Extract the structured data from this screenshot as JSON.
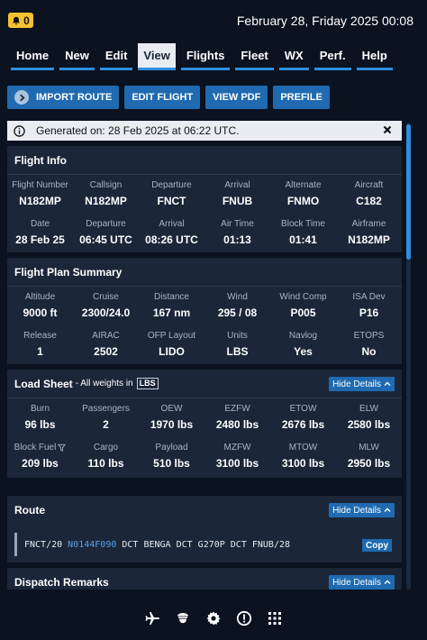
{
  "status": {
    "notification_count": "0",
    "datetime": "February 28, Friday 2025 00:08"
  },
  "tabs": [
    {
      "label": "Home"
    },
    {
      "label": "New"
    },
    {
      "label": "Edit"
    },
    {
      "label": "View"
    },
    {
      "label": "Flights"
    },
    {
      "label": "Fleet"
    },
    {
      "label": "WX"
    },
    {
      "label": "Perf."
    },
    {
      "label": "Help"
    }
  ],
  "active_tab": "View",
  "actions": {
    "import_route": "IMPORT ROUTE",
    "edit_flight": "EDIT FLIGHT",
    "view_pdf": "VIEW PDF",
    "prefile": "PREFILE"
  },
  "generated": "Generated on: 28 Feb 2025 at 06:22 UTC.",
  "flight_info": {
    "title": "Flight Info",
    "fields": [
      {
        "label": "Flight Number",
        "value": "N182MP"
      },
      {
        "label": "Callsign",
        "value": "N182MP"
      },
      {
        "label": "Departure",
        "value": "FNCT"
      },
      {
        "label": "Arrival",
        "value": "FNUB"
      },
      {
        "label": "Alternate",
        "value": "FNMO"
      },
      {
        "label": "Aircraft",
        "value": "C182"
      },
      {
        "label": "Date",
        "value": "28 Feb 25"
      },
      {
        "label": "Departure",
        "value": "06:45 UTC"
      },
      {
        "label": "Arrival",
        "value": "08:26 UTC"
      },
      {
        "label": "Air Time",
        "value": "01:13"
      },
      {
        "label": "Block Time",
        "value": "01:41"
      },
      {
        "label": "Airframe",
        "value": "N182MP"
      }
    ]
  },
  "plan_summary": {
    "title": "Flight Plan Summary",
    "fields": [
      {
        "label": "Altitude",
        "value": "9000 ft"
      },
      {
        "label": "Cruise",
        "value": "2300/24.0"
      },
      {
        "label": "Distance",
        "value": "167 nm"
      },
      {
        "label": "Wind",
        "value": "295 / 08"
      },
      {
        "label": "Wind Comp",
        "value": "P005"
      },
      {
        "label": "ISA Dev",
        "value": "P16"
      },
      {
        "label": "Release",
        "value": "1"
      },
      {
        "label": "AIRAC",
        "value": "2502"
      },
      {
        "label": "OFP Layout",
        "value": "LIDO"
      },
      {
        "label": "Units",
        "value": "LBS"
      },
      {
        "label": "Navlog",
        "value": "Yes"
      },
      {
        "label": "ETOPS",
        "value": "No"
      }
    ]
  },
  "load_sheet": {
    "title": "Load Sheet",
    "subtitle": "- All weights in",
    "unit": "LBS",
    "hide_label": "Hide Details",
    "fields": [
      {
        "label": "Burn",
        "value": "96 lbs"
      },
      {
        "label": "Passengers",
        "value": "2"
      },
      {
        "label": "OEW",
        "value": "1970 lbs"
      },
      {
        "label": "EZFW",
        "value": "2480 lbs"
      },
      {
        "label": "ETOW",
        "value": "2676 lbs"
      },
      {
        "label": "ELW",
        "value": "2580 lbs"
      },
      {
        "label": "Block Fuel",
        "value": "209 lbs"
      },
      {
        "label": "Cargo",
        "value": "110 lbs"
      },
      {
        "label": "Payload",
        "value": "510 lbs"
      },
      {
        "label": "MZFW",
        "value": "3100 lbs"
      },
      {
        "label": "MTOW",
        "value": "3100 lbs"
      },
      {
        "label": "MLW",
        "value": "2950 lbs"
      }
    ]
  },
  "route": {
    "title": "Route",
    "hide_label": "Hide Details",
    "prefix": "FNCT/20 ",
    "highlight": "N0144F090",
    "rest": " DCT BENGA DCT G270P DCT FNUB/28",
    "copy_label": "Copy"
  },
  "dispatch": {
    "title": "Dispatch Remarks",
    "hide_label": "Hide Details"
  },
  "colors": {
    "accent": "#2f8fe0",
    "button": "#1f6ab0",
    "badge": "#f2c230",
    "card": "#1b2638",
    "background": "#0b1220"
  },
  "bottom_nav_icons": [
    "airplane-icon",
    "pilot-icon",
    "gear-icon",
    "info-icon",
    "grid-icon"
  ]
}
